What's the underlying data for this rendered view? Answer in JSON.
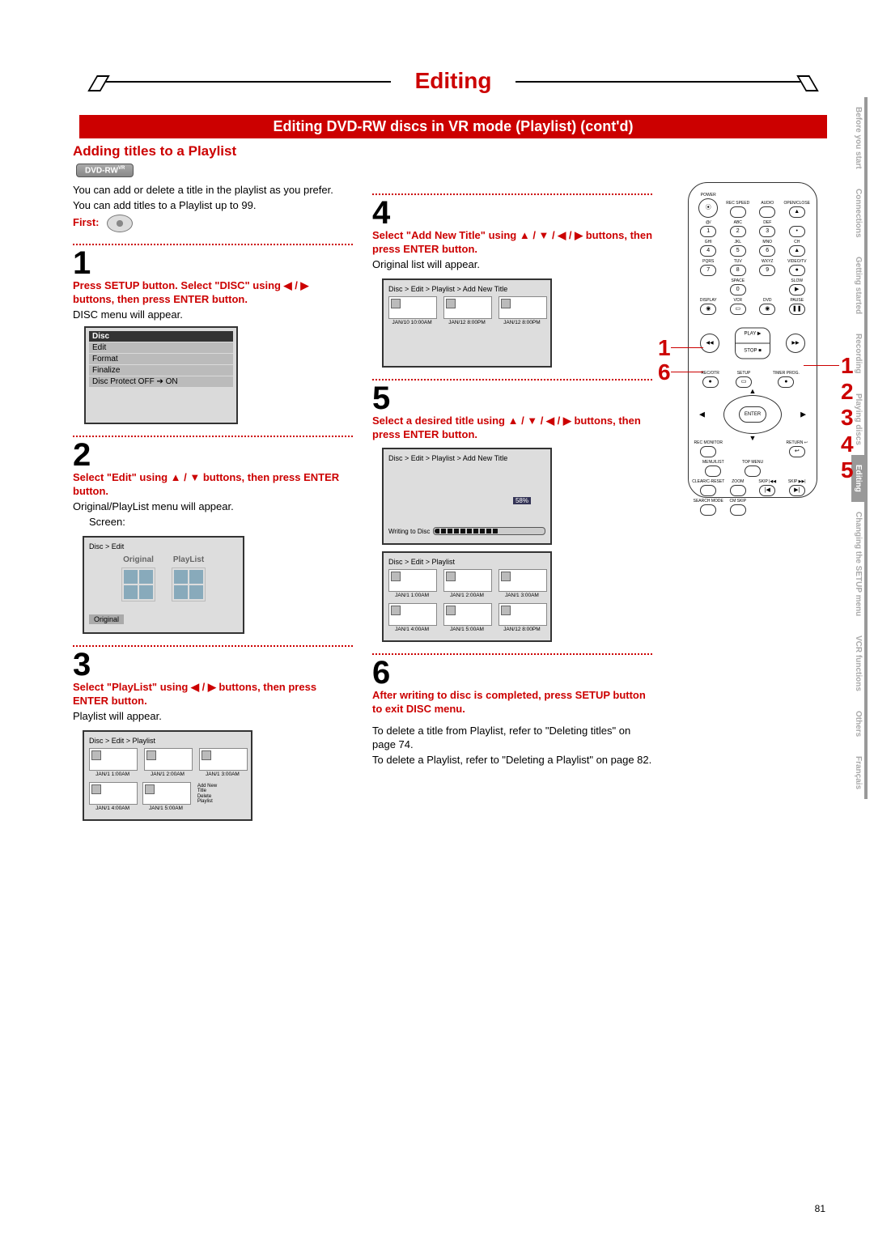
{
  "page_number": "81",
  "title_main": "Editing",
  "banner": "Editing DVD-RW discs in VR mode (Playlist) (cont'd)",
  "subhead": "Adding titles to a Playlist",
  "badge_text": "DVD-RW",
  "badge_super": "VR",
  "intro1": "You can add or delete a title in the playlist as you prefer.",
  "intro2": "You can add titles to a Playlist up to 99.",
  "first_label": "First:",
  "steps": {
    "s1": {
      "num": "1",
      "bold": "Press SETUP button. Select \"DISC\" using ◀ / ▶ buttons, then press ENTER button.",
      "plain": "DISC menu will appear."
    },
    "s2": {
      "num": "2",
      "bold": "Select \"Edit\" using ▲ / ▼ buttons, then press ENTER button.",
      "plain": "Original/PlayList menu will appear.",
      "screen_label": "Screen:"
    },
    "s3": {
      "num": "3",
      "bold": "Select \"PlayList\" using ◀ / ▶ buttons, then press ENTER button.",
      "plain": "Playlist will appear."
    },
    "s4": {
      "num": "4",
      "bold": "Select \"Add New Title\" using ▲ / ▼ / ◀ / ▶ buttons, then press ENTER button.",
      "plain": "Original list will appear."
    },
    "s5": {
      "num": "5",
      "bold": "Select a desired title using ▲ / ▼ / ◀ / ▶ buttons, then press ENTER button."
    },
    "s6": {
      "num": "6",
      "bold": "After writing to disc is completed, press SETUP button to exit DISC menu.",
      "note1": "To delete a title from Playlist, refer to \"Deleting titles\" on page 74.",
      "note2": "To delete a Playlist, refer to \"Deleting a Playlist\" on page 82."
    }
  },
  "disc_menu": {
    "header": "Disc",
    "items": [
      "Edit",
      "Format",
      "Finalize",
      "Disc Protect OFF ➔ ON"
    ]
  },
  "edit_screen": {
    "crumb": "Disc > Edit",
    "opt1": "Original",
    "opt2": "PlayList",
    "footer": "Original"
  },
  "playlist_screen_3": {
    "crumb": "Disc > Edit > Playlist",
    "thumbs": [
      "JAN/1 1:00AM",
      "JAN/1 2:00AM",
      "JAN/1 3:00AM",
      "JAN/1 4:00AM",
      "JAN/1 5:00AM"
    ],
    "extra": [
      "Add New",
      "Title",
      "Delete",
      "Playlist"
    ]
  },
  "addnew_screen_4": {
    "crumb": "Disc > Edit > Playlist > Add New Title",
    "thumbs": [
      "JAN/10 10:00AM",
      "JAN/12 8:00PM",
      "JAN/12 8:00PM"
    ]
  },
  "writing_screen_5": {
    "crumb": "Disc > Edit > Playlist > Add New Title",
    "pct_label": "58%",
    "writing_label": "Writing to Disc"
  },
  "playlist_screen_5b": {
    "crumb": "Disc > Edit > Playlist",
    "thumbs": [
      "JAN/1 1:00AM",
      "JAN/1 2:00AM",
      "JAN/1 3:00AM",
      "JAN/1 4:00AM",
      "JAN/1 5:00AM",
      "JAN/12 8:00PM"
    ]
  },
  "remote": {
    "top_row": [
      "POWER",
      "REC SPEED",
      "AUDIO",
      "OPEN/CLOSE"
    ],
    "numpad": [
      [
        "@/",
        "1"
      ],
      [
        "ABC",
        "2"
      ],
      [
        "DEF",
        "3"
      ],
      [
        "",
        "•"
      ],
      [
        "GHI",
        "4"
      ],
      [
        "JKL",
        "5"
      ],
      [
        "MNO",
        "6"
      ],
      [
        "CH",
        "▲"
      ],
      [
        "PQRS",
        "7"
      ],
      [
        "TUV",
        "8"
      ],
      [
        "WXYZ",
        "9"
      ],
      [
        "VIDEO/TV",
        ""
      ],
      [
        "",
        ""
      ],
      [
        "SPACE",
        "0"
      ],
      [
        "",
        ""
      ],
      [
        "SLOW",
        ""
      ]
    ],
    "row3": [
      "DISPLAY",
      "VCR",
      "DVD",
      "PAUSE"
    ],
    "play": "PLAY ▶",
    "stop": "STOP ■",
    "rew": "◀◀",
    "ffwd": "▶▶",
    "row5_left": [
      "REC/OTR",
      "REC MONITOR"
    ],
    "setup": "SETUP",
    "enter": "ENTER",
    "timer": "TIMER PROG.",
    "ret": "RETURN ↩",
    "arrows": [
      "▲",
      "▼",
      "◀",
      "▶"
    ],
    "row6": [
      "MENU/LIST",
      "TOP MENU"
    ],
    "row7": [
      "CLEAR/C-RESET",
      "ZOOM",
      "SKIP |◀◀",
      "SKIP ▶▶|"
    ],
    "row8": [
      "SEARCH MODE",
      "CM SKIP"
    ]
  },
  "callouts": {
    "left1": "1",
    "left6": "6",
    "right": [
      "1",
      "2",
      "3",
      "4",
      "5"
    ]
  },
  "tabs": [
    "Before you start",
    "Connections",
    "Getting started",
    "Recording",
    "Playing discs",
    "Editing",
    "Changing the SETUP menu",
    "VCR functions",
    "Others",
    "Français"
  ],
  "active_tab_index": 5
}
